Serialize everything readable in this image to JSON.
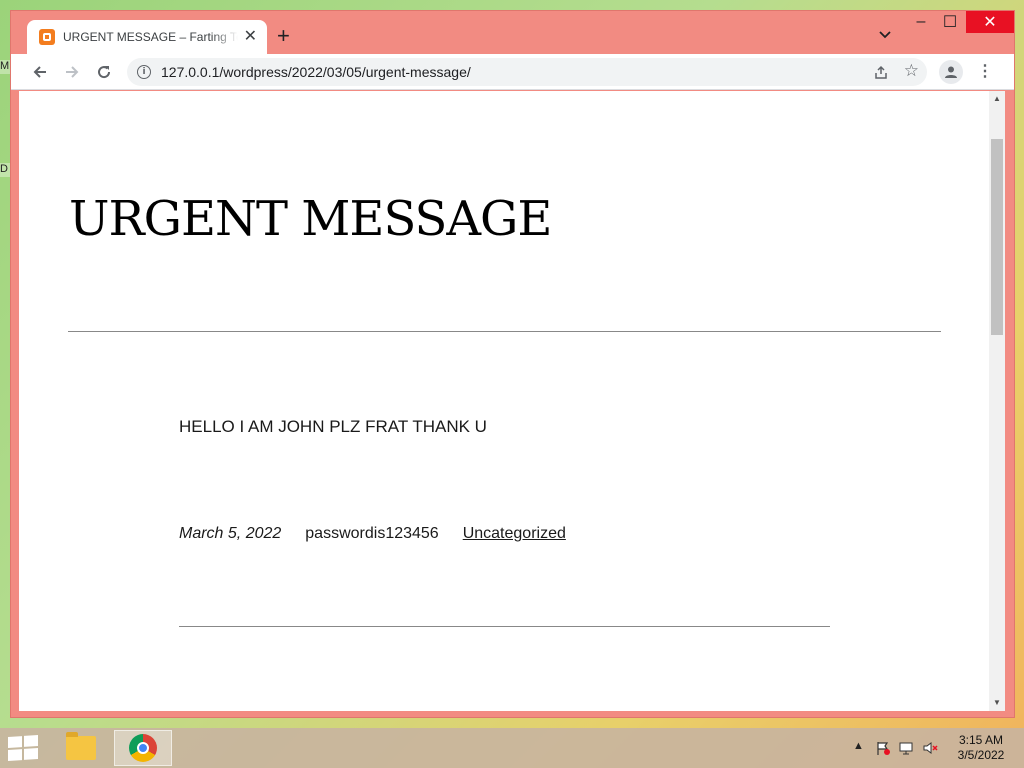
{
  "desktop": {
    "icon_a_label": "M",
    "icon_b_label": "D"
  },
  "browser": {
    "tab": {
      "title": "URGENT MESSAGE – Farting Tele",
      "close_glyph": "✕"
    },
    "new_tab_glyph": "+",
    "window_controls": {
      "minimize": "–",
      "maximize": "☐",
      "close": "✕"
    },
    "address": {
      "url": "127.0.0.1/wordpress/2022/03/05/urgent-message/"
    },
    "menu_glyph": "⋮",
    "star_glyph": "☆"
  },
  "page": {
    "title": "URGENT MESSAGE",
    "body": "HELLO I AM JOHN PLZ FRAT THANK U",
    "meta": {
      "date": "March 5, 2022",
      "author": "passwordis123456",
      "category": "Uncategorized"
    }
  },
  "taskbar": {
    "clock_time": "3:15 AM",
    "clock_date": "3/5/2022",
    "tray_chevron": "▲"
  },
  "colors": {
    "window_frame": "#f28b82",
    "close_button": "#e81123",
    "favicon": "#f37d1f"
  },
  "icons": [
    "back-arrow-icon",
    "forward-arrow-icon",
    "reload-icon",
    "info-icon",
    "share-icon",
    "star-icon",
    "profile-icon",
    "menu-icon",
    "tab-search-icon",
    "windows-start-icon",
    "file-explorer-icon",
    "chrome-icon",
    "flag-icon",
    "network-icon",
    "volume-muted-icon"
  ]
}
